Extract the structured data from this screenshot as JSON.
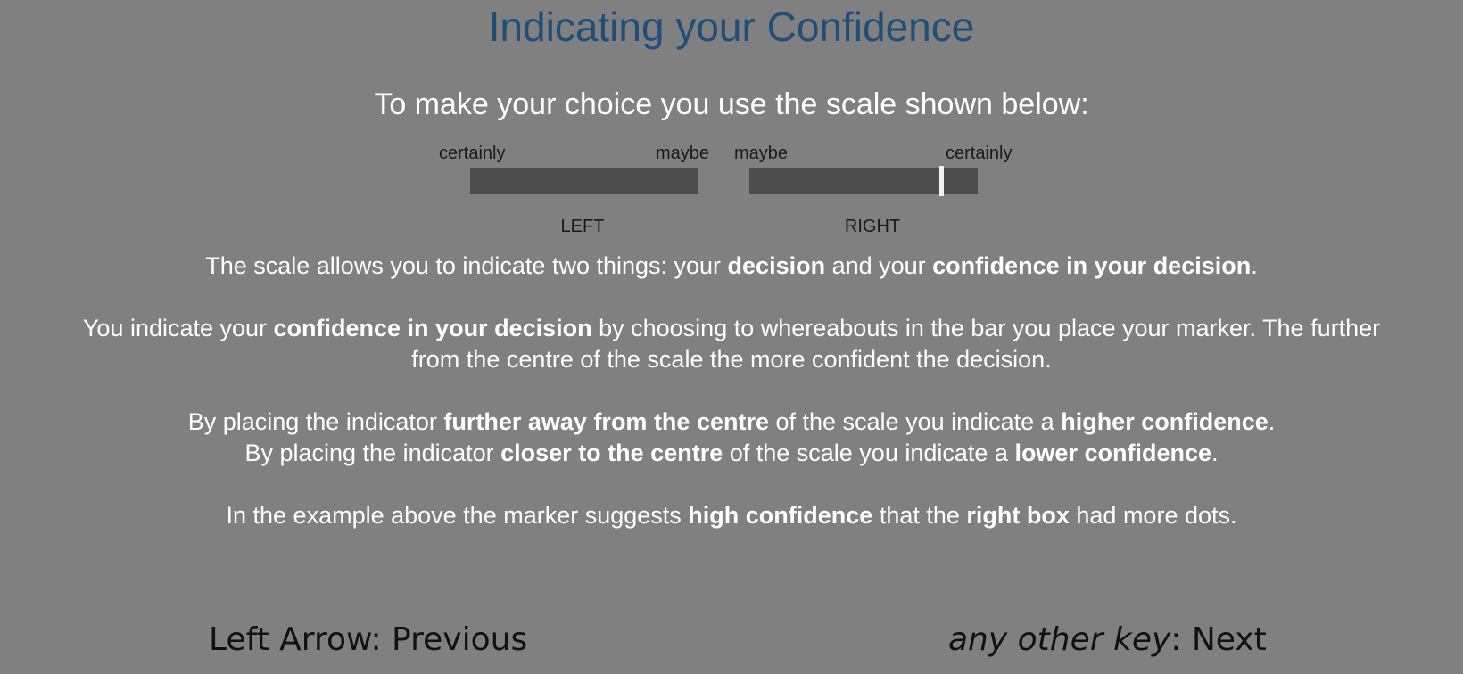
{
  "title": "Indicating your Confidence",
  "subtitle": "To make your choice you use the scale shown below:",
  "scale": {
    "left_outer_label": "certainly",
    "left_inner_label": "maybe",
    "right_inner_label": "maybe",
    "right_outer_label": "certainly",
    "left_side_label": "LEFT",
    "right_side_label": "RIGHT",
    "marker_position_on_right_bar_fraction": 0.84
  },
  "paragraphs": {
    "p1": {
      "t1": "The scale allows you to indicate two things: your ",
      "b1": "decision",
      "t2": " and your ",
      "b2": "confidence in your decision",
      "t3": "."
    },
    "p2": {
      "t1": "You indicate your ",
      "b1": "confidence in your decision",
      "t2": " by choosing to whereabouts in the bar you place your marker. The further",
      "t3": "from the centre of the scale the more confident the decision."
    },
    "p3": {
      "t1": "By placing the indicator ",
      "b1": "further away from the centre",
      "t2": " of the scale you indicate a ",
      "b2": "higher confidence",
      "t3": "."
    },
    "p4": {
      "t1": "By placing the indicator ",
      "b1": "closer to the centre",
      "t2": " of the scale you indicate a ",
      "b2": "lower confidence",
      "t3": "."
    },
    "p5": {
      "t1": "In the example above the marker suggests ",
      "b1": "high confidence",
      "t2": " that the ",
      "b2": "right box",
      "t3": " had more dots."
    }
  },
  "navigation": {
    "previous_key": "Left Arrow",
    "previous_action": ": Previous",
    "next_key": "any other key",
    "next_action": ": Next"
  },
  "colors": {
    "background": "#808080",
    "title": "#1f4e79",
    "bar": "#4d4d4d",
    "marker": "#f2f2f2"
  }
}
